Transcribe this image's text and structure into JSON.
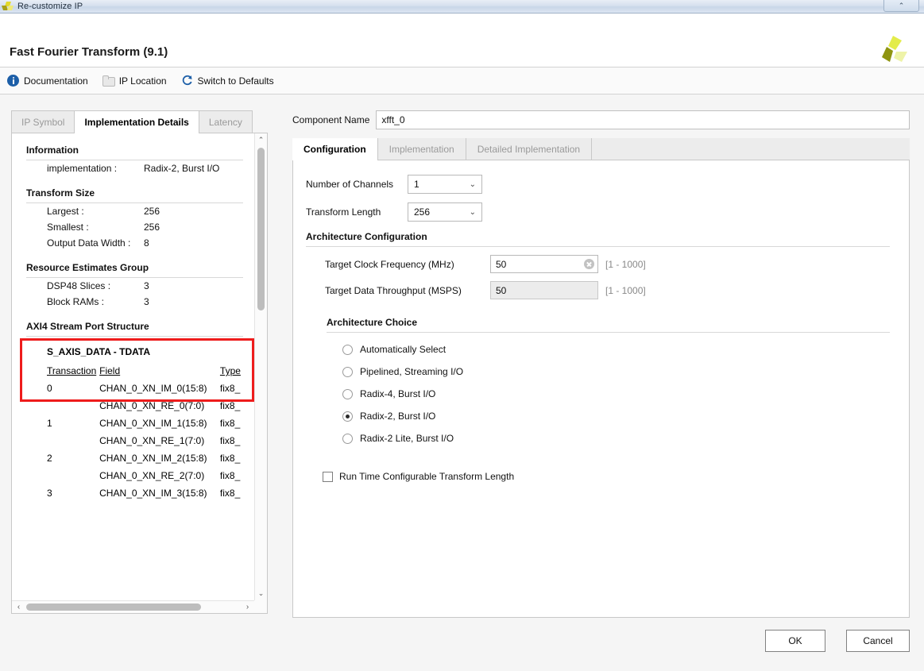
{
  "window": {
    "title": "Re-customize IP",
    "icon": "xilinx-logo-icon",
    "control_glyph": "⌃"
  },
  "header": {
    "title": "Fast Fourier Transform (9.1)",
    "logo": "xilinx-logo-icon"
  },
  "toolbar": {
    "items": [
      {
        "label": "Documentation",
        "icon": "info-icon"
      },
      {
        "label": "IP Location",
        "icon": "folder-icon"
      },
      {
        "label": "Switch to Defaults",
        "icon": "refresh-icon"
      }
    ]
  },
  "left_panel": {
    "tabs": [
      {
        "label": "IP Symbol",
        "active": false
      },
      {
        "label": "Implementation Details",
        "active": true
      },
      {
        "label": "Latency",
        "active": false
      }
    ],
    "sections": {
      "information": {
        "heading": "Information",
        "rows": [
          {
            "key": "implementation :",
            "value": "Radix-2, Burst I/O"
          }
        ]
      },
      "transform_size": {
        "heading": "Transform Size",
        "rows": [
          {
            "key": "Largest :",
            "value": "256"
          },
          {
            "key": "Smallest :",
            "value": "256"
          },
          {
            "key": "Output Data Width :",
            "value": "8"
          }
        ]
      },
      "resource_estimates": {
        "heading": "Resource Estimates Group",
        "highlight_color": "#ee1c1c",
        "rows": [
          {
            "key": "DSP48 Slices :",
            "value": "3"
          },
          {
            "key": "Block RAMs :",
            "value": "3"
          }
        ]
      },
      "axi4_port_structure": {
        "heading": "AXI4 Stream Port Structure",
        "subheading": "S_AXIS_DATA - TDATA",
        "columns": [
          "Transaction",
          "Field",
          "Type"
        ],
        "rows": [
          {
            "transaction": "0",
            "field": "CHAN_0_XN_IM_0(15:8)",
            "type": "fix8_"
          },
          {
            "transaction": "",
            "field": "CHAN_0_XN_RE_0(7:0)",
            "type": "fix8_"
          },
          {
            "transaction": "1",
            "field": "CHAN_0_XN_IM_1(15:8)",
            "type": "fix8_"
          },
          {
            "transaction": "",
            "field": "CHAN_0_XN_RE_1(7:0)",
            "type": "fix8_"
          },
          {
            "transaction": "2",
            "field": "CHAN_0_XN_IM_2(15:8)",
            "type": "fix8_"
          },
          {
            "transaction": "",
            "field": "CHAN_0_XN_RE_2(7:0)",
            "type": "fix8_"
          },
          {
            "transaction": "3",
            "field": "CHAN_0_XN_IM_3(15:8)",
            "type": "fix8_"
          }
        ]
      }
    },
    "scroll": {
      "up_arrow": "⌃",
      "down_arrow": "⌄",
      "left_arrow": "‹",
      "right_arrow": "›"
    }
  },
  "right_panel": {
    "component_name_label": "Component Name",
    "component_name_value": "xfft_0",
    "tabs": [
      {
        "label": "Configuration",
        "active": true
      },
      {
        "label": "Implementation",
        "active": false
      },
      {
        "label": "Detailed Implementation",
        "active": false
      }
    ],
    "number_of_channels": {
      "label": "Number of Channels",
      "value": "1"
    },
    "transform_length": {
      "label": "Transform Length",
      "value": "256"
    },
    "architecture_configuration": {
      "heading": "Architecture Configuration",
      "target_clock_frequency": {
        "label": "Target Clock Frequency (MHz)",
        "value": "50",
        "range": "[1 - 1000]",
        "clear_icon": "clear-icon"
      },
      "target_data_throughput": {
        "label": "Target Data Throughput (MSPS)",
        "value": "50",
        "range": "[1 - 1000]"
      }
    },
    "architecture_choice": {
      "heading": "Architecture Choice",
      "options": [
        {
          "label": "Automatically Select",
          "selected": false
        },
        {
          "label": "Pipelined, Streaming I/O",
          "selected": false
        },
        {
          "label": "Radix-4, Burst I/O",
          "selected": false
        },
        {
          "label": "Radix-2, Burst I/O",
          "selected": true
        },
        {
          "label": "Radix-2 Lite, Burst I/O",
          "selected": false
        }
      ]
    },
    "run_time_configurable": {
      "label": "Run Time Configurable Transform Length",
      "checked": false
    },
    "dropdown_chevron": "⌄"
  },
  "footer": {
    "ok_label": "OK",
    "cancel_label": "Cancel"
  }
}
